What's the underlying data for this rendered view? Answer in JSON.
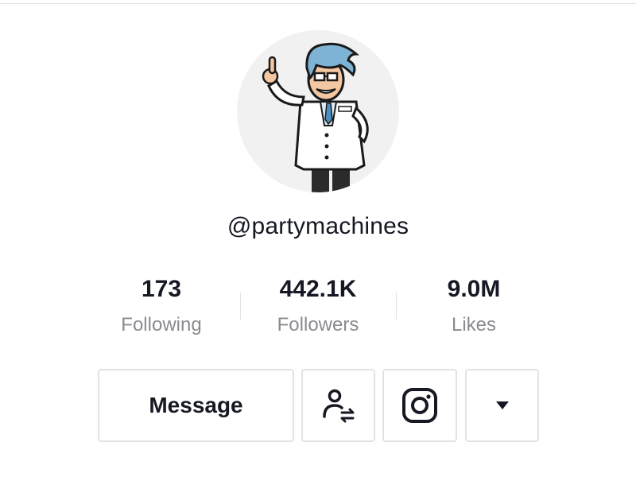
{
  "profile": {
    "username": "@partymachines",
    "avatar_icon": "cartoon-scientist-avatar"
  },
  "stats": [
    {
      "value": "173",
      "label": "Following"
    },
    {
      "value": "442.1K",
      "label": "Followers"
    },
    {
      "value": "9.0M",
      "label": "Likes"
    }
  ],
  "actions": {
    "message_label": "Message",
    "follow_icon": "person-swap-icon",
    "instagram_icon": "instagram-icon",
    "more_icon": "caret-down-icon"
  },
  "colors": {
    "text_primary": "#161823",
    "text_secondary": "#8a8b91",
    "border": "#e3e3e4",
    "avatar_bg": "#f1f1f2"
  }
}
